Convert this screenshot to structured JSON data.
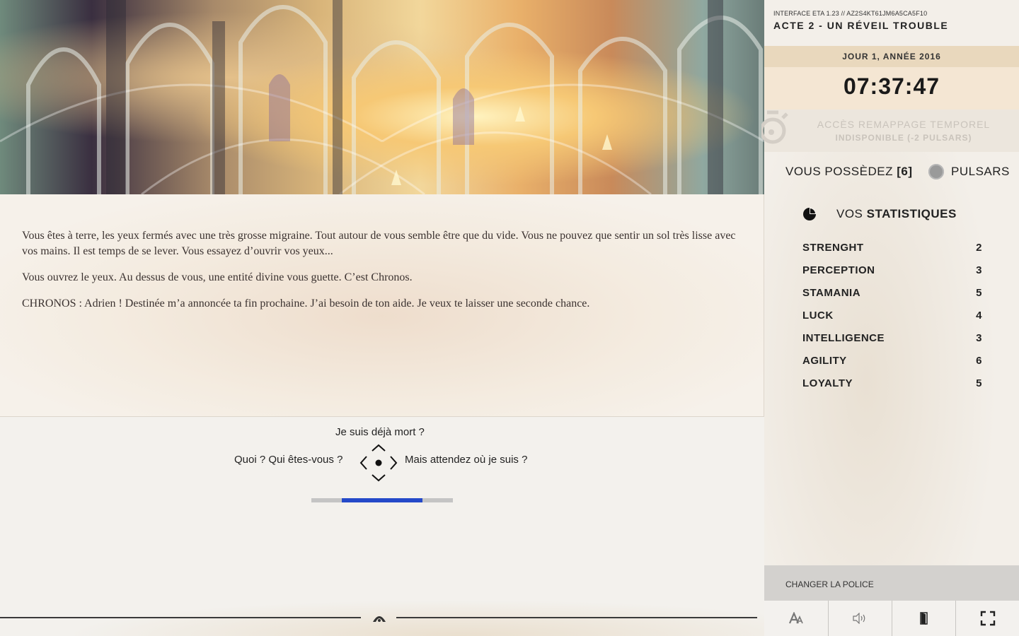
{
  "story": {
    "paragraphs": [
      "Vous êtes à terre, les yeux fermés avec une très grosse migraine. Tout autour de vous semble être que du vide. Vous ne pouvez que sentir un sol très lisse avec vos mains. Il est temps de se lever. Vous essayez d’ouvrir vos yeux...",
      "Vous ouvrez le yeux. Au dessus de vous, une entité divine vous guette. C’est Chronos.",
      "CHRONOS : Adrien ! Destinée m’a annoncée ta fin prochaine. J’ai besoin de ton aide. Je veux te laisser une seconde chance."
    ]
  },
  "choices": {
    "up": "Je suis déjà mort ?",
    "left": "Quoi ? Qui êtes-vous ?",
    "right": "Mais attendez où je suis ?",
    "timer_progress": 0.57
  },
  "panel": {
    "interface_label": "INTERFACE ETA 1.23 // AZ2S4KT61JM6A5CA5F10",
    "act_title": "ACTE 2 - UN RÉVEIL TROUBLE",
    "day": "JOUR 1, ANNÉE 2016",
    "clock": "07:37:47",
    "remap_line1": "ACCÈS REMAPPAGE TEMPOREL",
    "remap_line2": "INDISPONIBLE (-2 PULSARS)",
    "owned_prefix": "VOUS POSSÈDEZ",
    "owned_count": "[6]",
    "pulsars_label": "PULSARS",
    "stats_title_prefix": "VOS",
    "stats_title_bold": "STATISTIQUES",
    "stats": [
      {
        "name": "STRENGHT",
        "value": "2"
      },
      {
        "name": "PERCEPTION",
        "value": "3"
      },
      {
        "name": "STAMANIA",
        "value": "5"
      },
      {
        "name": "LUCK",
        "value": "4"
      },
      {
        "name": "INTELLIGENCE",
        "value": "3"
      },
      {
        "name": "AGILITY",
        "value": "6"
      },
      {
        "name": "LOYALTY",
        "value": "5"
      }
    ],
    "font_button": "CHANGER LA POLICE"
  },
  "icons": {
    "font": "font-size-icon",
    "sound": "speaker-icon",
    "exit": "door-exit-icon",
    "fullscreen": "fullscreen-icon"
  },
  "colors": {
    "timer_fill": "#2449c9",
    "timer_track": "#c4c4c4",
    "day_bar": "#e9d8bd",
    "font_bar": "#d3d1ce"
  }
}
